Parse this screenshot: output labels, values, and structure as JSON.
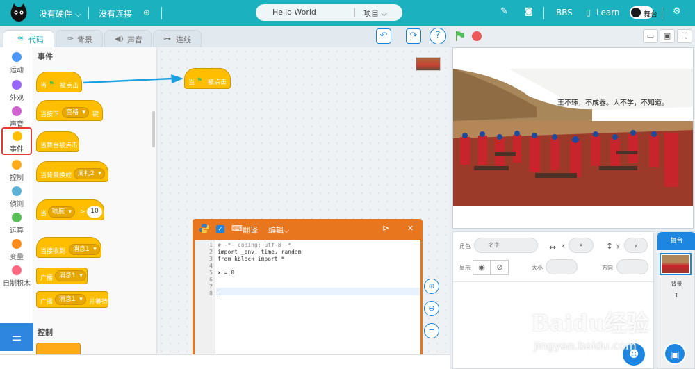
{
  "topbar": {
    "hardware": "没有硬件",
    "connection": "没有连接",
    "project_name": "Hello World",
    "project_menu": "项目",
    "bbs": "BBS",
    "learn": "Learn",
    "stage_toggle": "舞台"
  },
  "tabs": [
    {
      "label": "代码",
      "active": true
    },
    {
      "label": "背景",
      "active": false
    },
    {
      "label": "声音",
      "active": false
    },
    {
      "label": "连线",
      "active": false
    }
  ],
  "categories": [
    {
      "label": "运动",
      "color": "#4c97ff"
    },
    {
      "label": "外观",
      "color": "#9966ff"
    },
    {
      "label": "声音",
      "color": "#cf63cf"
    },
    {
      "label": "事件",
      "color": "#ffbf00",
      "selected": true
    },
    {
      "label": "控制",
      "color": "#ffab19"
    },
    {
      "label": "侦测",
      "color": "#5cb1d6"
    },
    {
      "label": "运算",
      "color": "#59c059"
    },
    {
      "label": "变量",
      "color": "#ff8c1a"
    },
    {
      "label": "自制积木",
      "color": "#ff6680"
    }
  ],
  "palette": {
    "section_events": "事件",
    "section_control": "控制",
    "blocks": {
      "flag_clicked_pre": "当",
      "flag_clicked_post": "被点击",
      "key_pressed_pre": "当按下",
      "key_pressed_value": "空格",
      "key_pressed_post": "键",
      "stage_clicked": "当舞台被点击",
      "backdrop_switch": "当背景换成",
      "backdrop_value": "周礼2",
      "loudness_pre": "当",
      "loudness_value": "响度",
      "loudness_op": ">",
      "loudness_num": "10",
      "receive_pre": "当接收到",
      "receive_value": "消息1",
      "broadcast": "广播",
      "broadcast_value": "消息1",
      "broadcast_wait": "广播",
      "broadcast_wait_value": "消息1",
      "broadcast_wait_post": "并等待"
    }
  },
  "workspace_block": {
    "pre": "当",
    "post": "被点击"
  },
  "editor": {
    "translate": "翻译",
    "edit": "编辑",
    "close": "✕",
    "line_numbers": [
      "1",
      "2",
      "3",
      "4",
      "5",
      "6",
      "7",
      "8"
    ],
    "lines": [
      "# -*- coding: utf-8 -*-",
      "import _env, time, random",
      "from kblock import *",
      "",
      "x = 0",
      "",
      "",
      ""
    ]
  },
  "stage_text": "王不琢，不成器。人不学，不知道。",
  "sprite_props": {
    "role_label": "角色",
    "name_placeholder": "名字",
    "x_label": "x",
    "x_placeholder": "x",
    "y_label": "y",
    "y_placeholder": "y",
    "show_label": "显示",
    "size_label": "大小",
    "direction_label": "方向"
  },
  "stage_panel": {
    "title": "舞台",
    "backdrop_label": "背景",
    "backdrop_count": "1"
  },
  "watermark": {
    "main": "Baidu经验",
    "sub": "jingyan.baidu.com"
  }
}
